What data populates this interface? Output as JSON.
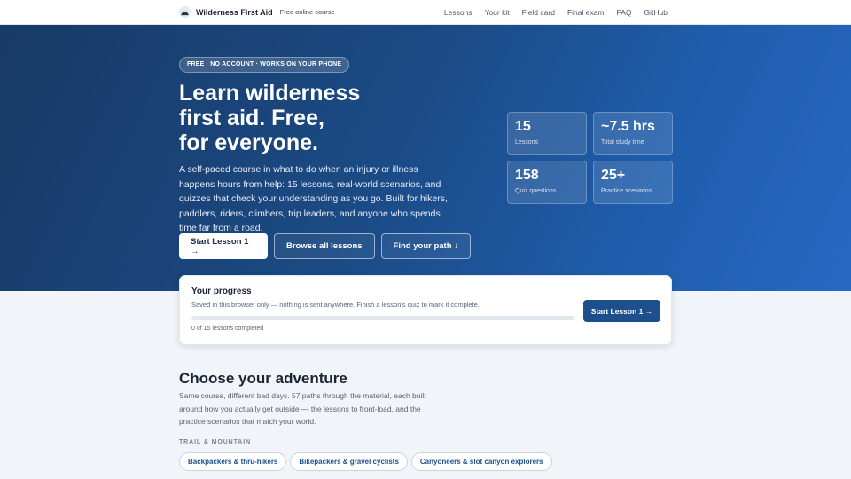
{
  "header": {
    "brand_name": "Wilderness First Aid",
    "brand_tagline": "Free online course",
    "nav": [
      {
        "label": "Lessons"
      },
      {
        "label": "Your kit"
      },
      {
        "label": "Field card"
      },
      {
        "label": "Final exam"
      },
      {
        "label": "FAQ"
      },
      {
        "label": "GitHub"
      }
    ]
  },
  "hero": {
    "badge": "FREE · NO ACCOUNT · WORKS ON YOUR PHONE",
    "title_lines": [
      "Learn wilderness",
      "first aid. Free,",
      "for everyone."
    ],
    "description": "A self-paced course in what to do when an injury or illness happens hours from help: 15 lessons, real-world scenarios, and quizzes that check your understanding as you go. Built for hikers, paddlers, riders, climbers, trip leaders, and anyone who spends time far from a road.",
    "buttons": {
      "start": "Start Lesson 1 →",
      "browse": "Browse all lessons",
      "path": "Find your path ↓"
    },
    "stats": [
      {
        "value": "15",
        "label": "Lessons"
      },
      {
        "value": "~7.5 hrs",
        "label": "Total study time"
      },
      {
        "value": "158",
        "label": "Quiz questions"
      },
      {
        "value": "25+",
        "label": "Practice scenarios"
      }
    ]
  },
  "progress": {
    "title": "Your progress",
    "description": "Saved in this browser only — nothing is sent anywhere. Finish a lesson's quiz to mark it complete.",
    "fraction": 0,
    "count_text": "0 of 15 lessons completed",
    "button": "Start Lesson 1 →"
  },
  "adventure": {
    "title": "Choose your adventure",
    "description": "Same course, different bad days. 57 paths through the material, each built around how you actually get outside — the lessons to front-load, and the practice scenarios that match your world.",
    "category": "TRAIL & MOUNTAIN",
    "chips": [
      {
        "label": "Backpackers & thru-hikers"
      },
      {
        "label": "Bikepackers & gravel cyclists"
      },
      {
        "label": "Canyoneers & slot canyon explorers"
      }
    ]
  },
  "colors": {
    "hero_gradient_start": "#183a66",
    "hero_gradient_end": "#2768c4",
    "accent": "#1d4f8c"
  }
}
